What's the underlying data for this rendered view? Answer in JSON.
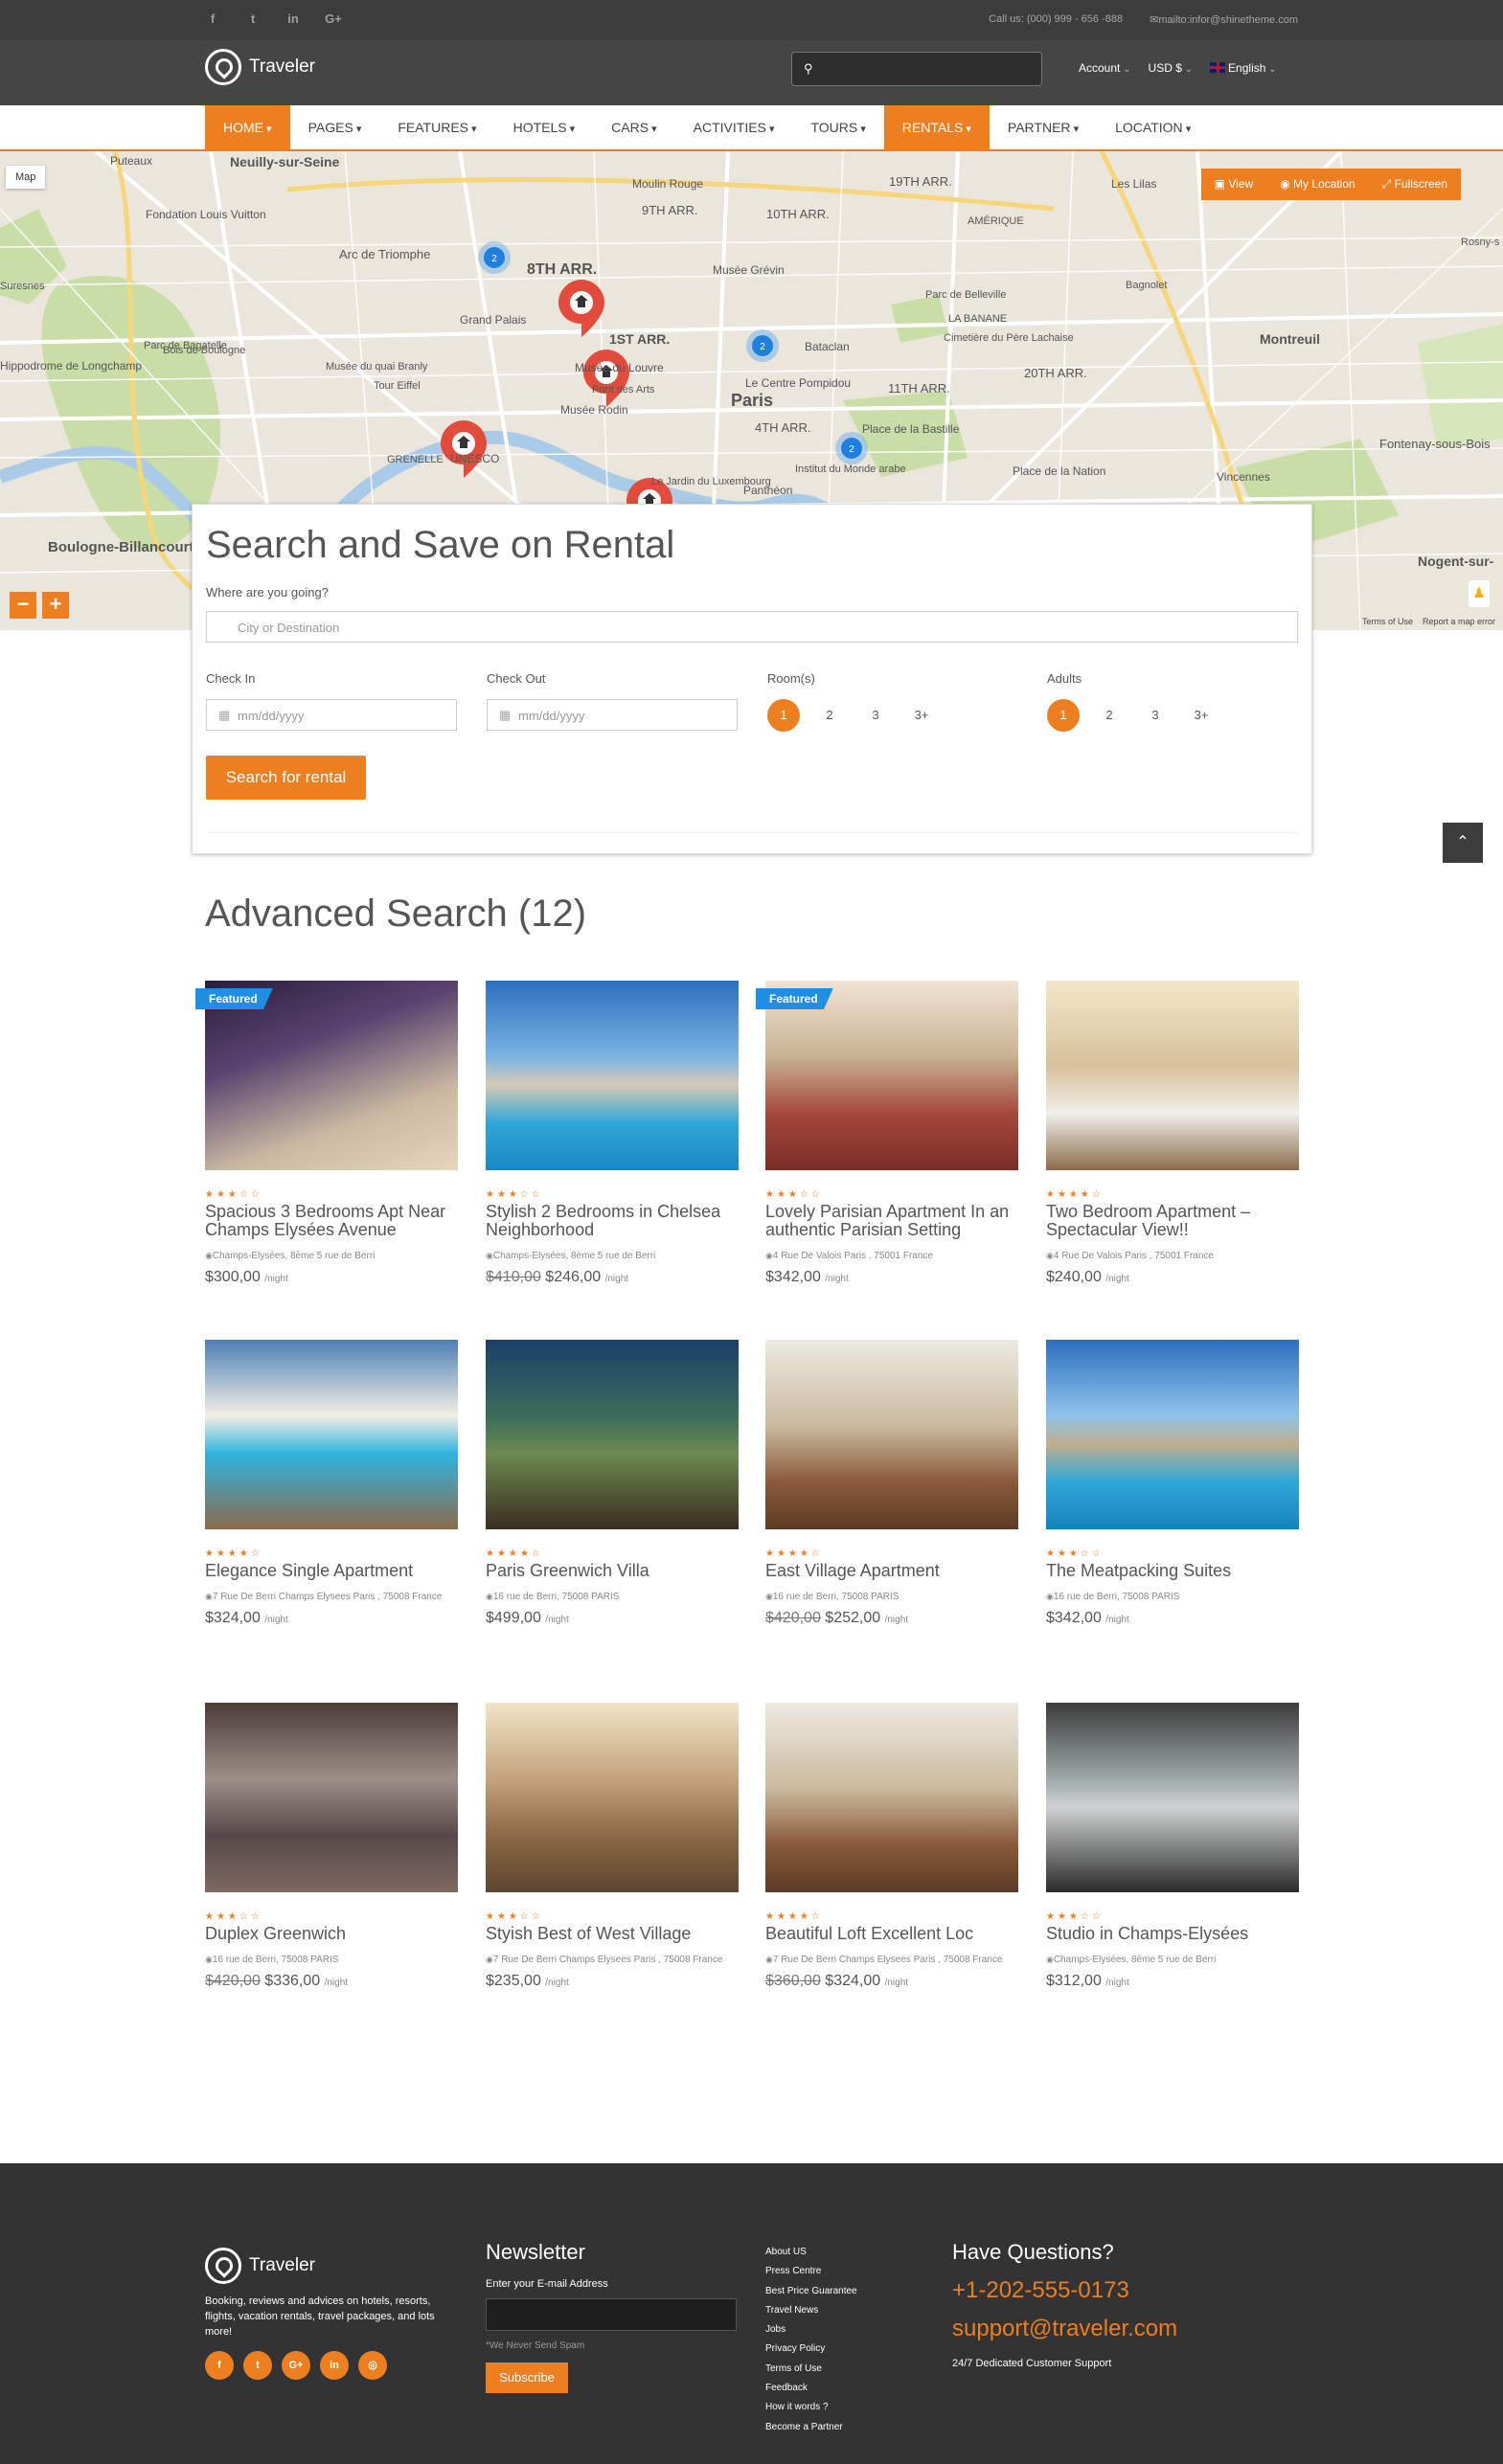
{
  "topbar": {
    "social": [
      "f",
      "t",
      "in",
      "G+"
    ],
    "phone": "Call us: (000) 999 - 656 -888",
    "email": "mailto:infor@shinetheme.com"
  },
  "header": {
    "logo": "Traveler",
    "account": "Account",
    "currency": "USD $",
    "language": "English"
  },
  "nav": {
    "items": [
      {
        "label": "HOME",
        "active": true
      },
      {
        "label": "PAGES",
        "active": false
      },
      {
        "label": "FEATURES",
        "active": false
      },
      {
        "label": "HOTELS",
        "active": false
      },
      {
        "label": "CARS",
        "active": false
      },
      {
        "label": "ACTIVITIES",
        "active": false
      },
      {
        "label": "TOURS",
        "active": false
      },
      {
        "label": "RENTALS",
        "active": true
      },
      {
        "label": "PARTNER",
        "active": false
      },
      {
        "label": "LOCATION",
        "active": false
      }
    ]
  },
  "map": {
    "type_button": "Map",
    "view": "View",
    "my_location": "My Location",
    "fullscreen": "Fullscreen",
    "zoom_out": "−",
    "zoom_in": "+",
    "terms": "Terms of Use",
    "report": "Report a map error",
    "labels": [
      "Neuilly-sur-Seine",
      "Puteaux",
      "Fondation Louis Vuitton",
      "Moulin Rouge",
      "9TH ARR.",
      "10TH ARR.",
      "19TH ARR.",
      "Les Lilas",
      "Arc de Triomphe",
      "8TH ARR.",
      "Musée Grévin",
      "Bagnolet",
      "Parc de Bagatelle",
      "Grand Palais",
      "1ST ARR.",
      "Bataclan",
      "Montreuil",
      "Bois de Boulogne",
      "Musée du quai Branly",
      "Musée du Louvre",
      "Le Centre Pompidou",
      "20TH ARR.",
      "Tour Eiffel",
      "Pont des Arts",
      "Paris",
      "11TH ARR.",
      "Musée Rodin",
      "4TH ARR.",
      "Place de la Bastille",
      "GRENELLE",
      "UNESCO",
      "Institut du Monde arabe",
      "Place de la Nation",
      "Panthéon",
      "Fontenay-sous-Bois",
      "Vincennes",
      "Boulogne-Billancourt",
      "Nogent-sur-",
      "Le Jardin du Luxembourg",
      "Hippodrome de Longchamp",
      "Suresnes",
      "Rosny-s",
      "AMÉRIQUE",
      "LA BANANE",
      "Parc de Belleville",
      "Cimetière du Père Lachaise"
    ],
    "clusters": [
      "2",
      "2",
      "2"
    ]
  },
  "search": {
    "title": "Search and Save on Rental",
    "where_label": "Where are you going?",
    "where_placeholder": "City or Destination",
    "checkin_label": "Check In",
    "checkout_label": "Check Out",
    "date_placeholder": "mm/dd/yyyy",
    "rooms_label": "Room(s)",
    "adults_label": "Adults",
    "options": [
      "1",
      "2",
      "3",
      "3+"
    ],
    "button": "Search for rental"
  },
  "results": {
    "title": "Advanced Search (12)",
    "per_night": "/night",
    "featured_label": "Featured",
    "items": [
      {
        "title": "Spacious 3 Bedrooms Apt Near Champs Elysées Avenue",
        "address": "Champs-Elysées, 8ème 5 rue de Berri",
        "old_price": "",
        "price": "$300,00",
        "stars": "★★★☆☆",
        "featured": true
      },
      {
        "title": "Stylish 2 Bedrooms in Chelsea Neighborhood",
        "address": "Champs-Elysées, 8ème 5 rue de Berri",
        "old_price": "$410,00",
        "price": "$246,00",
        "stars": "★★★☆☆",
        "featured": false
      },
      {
        "title": "Lovely Parisian Apartment In an authentic Parisian Setting",
        "address": "4 Rue De Valois Paris , 75001 France",
        "old_price": "",
        "price": "$342,00",
        "stars": "★★★☆☆",
        "featured": true
      },
      {
        "title": "Two Bedroom Apartment – Spectacular View!!",
        "address": "4 Rue De Valois Paris , 75001 France",
        "old_price": "",
        "price": "$240,00",
        "stars": "★★★★☆",
        "featured": false
      },
      {
        "title": "Elegance Single Apartment",
        "address": "7 Rue De Berri Champs Elysees Paris , 75008 France",
        "old_price": "",
        "price": "$324,00",
        "stars": "★★★★☆",
        "featured": false
      },
      {
        "title": "Paris Greenwich Villa",
        "address": "16 rue de Berri, 75008 PARIS",
        "old_price": "",
        "price": "$499,00",
        "stars": "★★★★☆",
        "featured": false
      },
      {
        "title": "East Village Apartment",
        "address": "16 rue de Berri, 75008 PARIS",
        "old_price": "$420,00",
        "price": "$252,00",
        "stars": "★★★★☆",
        "featured": false
      },
      {
        "title": "The Meatpacking Suites",
        "address": "16 rue de Berri, 75008 PARIS",
        "old_price": "",
        "price": "$342,00",
        "stars": "★★★☆☆",
        "featured": false
      },
      {
        "title": "Duplex Greenwich",
        "address": "16 rue de Berri, 75008 PARIS",
        "old_price": "$420,00",
        "price": "$336,00",
        "stars": "★★★☆☆",
        "featured": false
      },
      {
        "title": "Styish Best of West Village",
        "address": "7 Rue De Berri Champs Elysees Paris , 75008 France",
        "old_price": "",
        "price": "$235,00",
        "stars": "★★★☆☆",
        "featured": false
      },
      {
        "title": "Beautiful Loft Excellent Loc",
        "address": "7 Rue De Berri Champs Elysees Paris , 75008 France",
        "old_price": "$360,00",
        "price": "$324,00",
        "stars": "★★★★☆",
        "featured": false
      },
      {
        "title": "Studio in Champs-Elysées",
        "address": "Champs-Elysées, 8ème 5 rue de Berri",
        "old_price": "",
        "price": "$312,00",
        "stars": "★★★☆☆",
        "featured": false
      }
    ]
  },
  "footer": {
    "logo": "Traveler",
    "description": "Booking, reviews and advices on hotels, resorts, flights, vacation rentals, travel packages, and lots more!",
    "social": [
      "f",
      "t",
      "G+",
      "in",
      "◎"
    ],
    "newsletter_title": "Newsletter",
    "newsletter_label": "Enter your E-mail Address",
    "newsletter_note": "*We Never Send Spam",
    "subscribe": "Subscribe",
    "links": [
      "About US",
      "Press Centre",
      "Best Price Guarantee",
      "Travel News",
      "Jobs",
      "Privacy Policy",
      "Terms of Use",
      "Feedback",
      "How it words ?",
      "Become a Partner"
    ],
    "questions_title": "Have Questions?",
    "phone": "+1-202-555-0173",
    "email": "support@traveler.com",
    "support": "24/7 Dedicated Customer Support"
  }
}
